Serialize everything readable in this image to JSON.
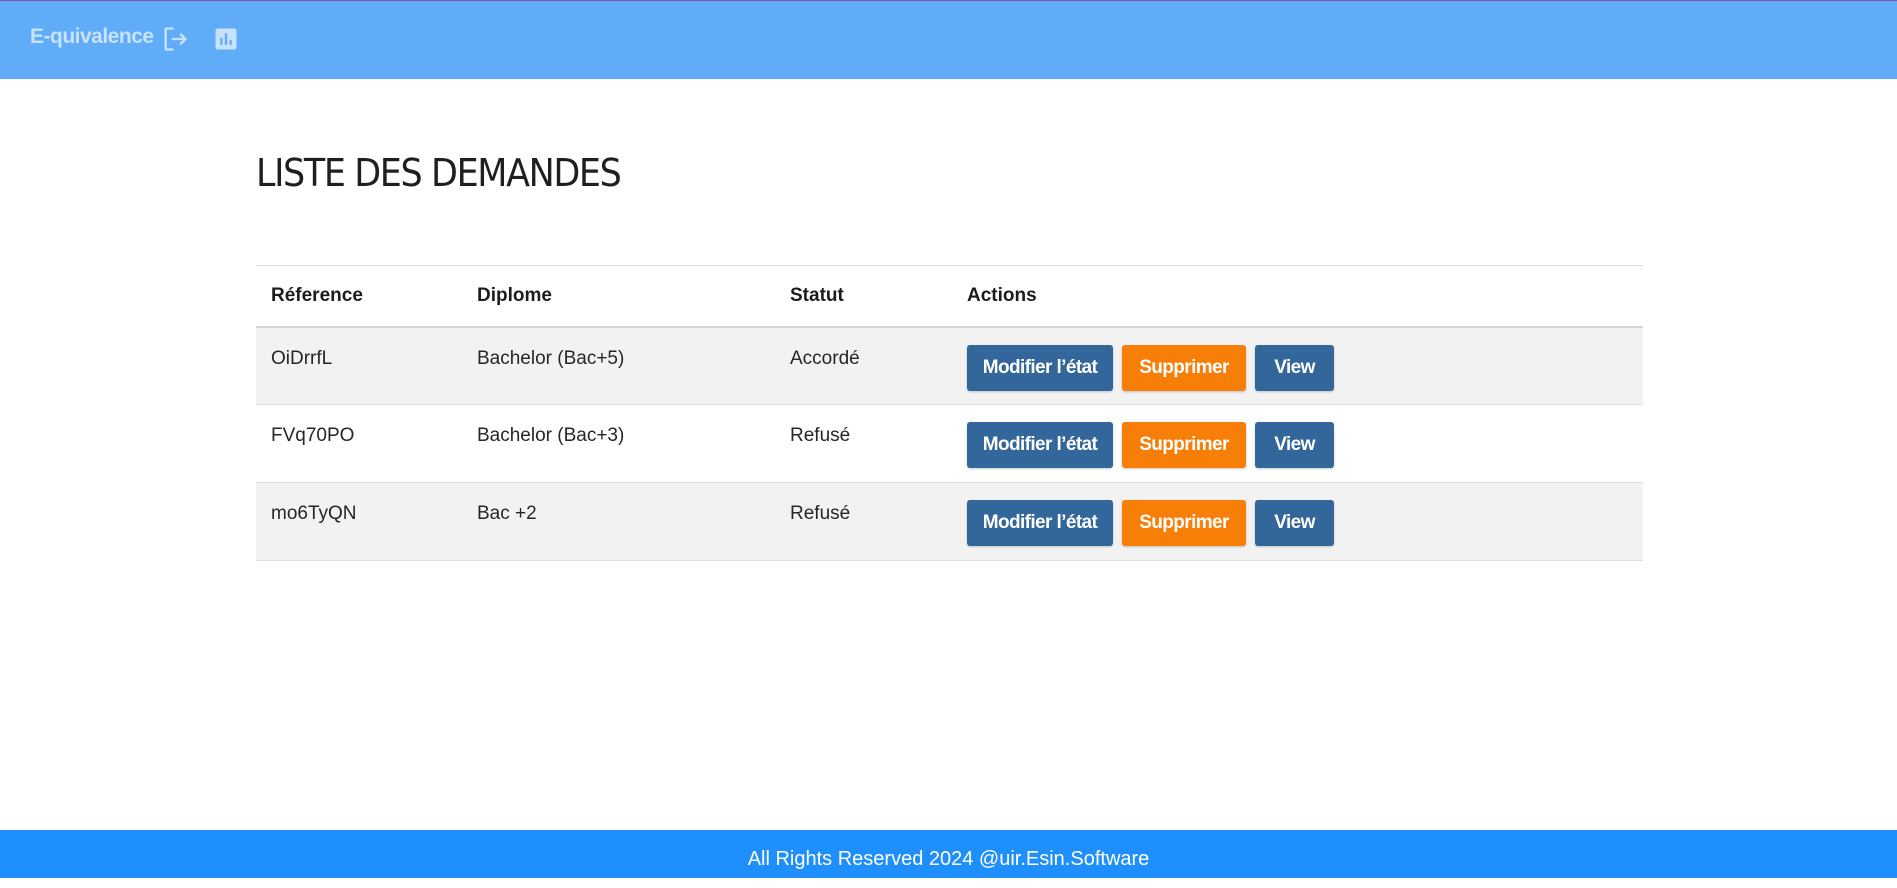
{
  "navbar": {
    "brand": "E-quivalence",
    "icons": [
      "logout-icon",
      "chart-icon"
    ],
    "background": "#61acf8",
    "text_color": "#c7e2fd"
  },
  "page": {
    "title": "LISTE DES DEMANDES"
  },
  "table": {
    "headers": {
      "reference": "Réference",
      "diplome": "Diplome",
      "statut": "Statut",
      "actions": "Actions"
    },
    "rows": [
      {
        "reference": "OiDrrfL",
        "diplome": "Bachelor (Bac+5)",
        "statut": "Accordé"
      },
      {
        "reference": "FVq70PO",
        "diplome": "Bachelor (Bac+3)",
        "statut": "Refusé"
      },
      {
        "reference": "mo6TyQN",
        "diplome": "Bac +2",
        "statut": "Refusé"
      }
    ],
    "action_labels": {
      "modify": "Modifier l’état",
      "delete": "Supprimer",
      "view": "View"
    },
    "colors": {
      "modify": "#33669a",
      "delete": "#f77f08",
      "view": "#33669a"
    }
  },
  "footer": {
    "text": "All Rights Reserved 2024 @uir.Esin.Software",
    "background": "#1e8ffc"
  }
}
